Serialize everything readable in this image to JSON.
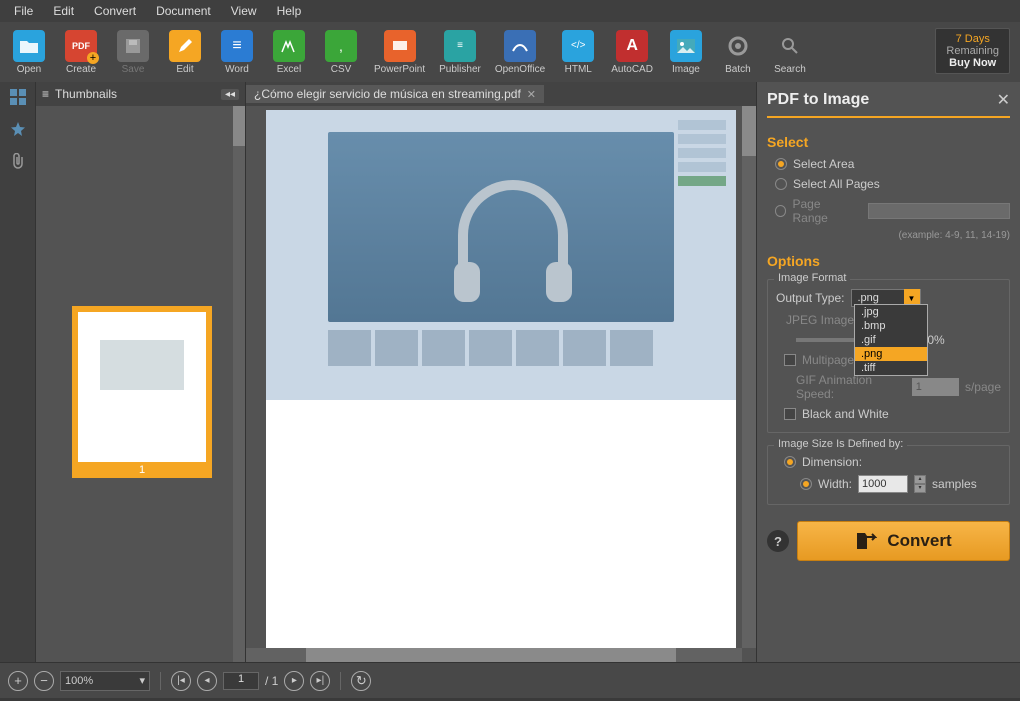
{
  "menubar": [
    "File",
    "Edit",
    "Convert",
    "Document",
    "View",
    "Help"
  ],
  "toolbar": {
    "open": "Open",
    "create": "Create",
    "save": "Save",
    "edit": "Edit",
    "word": "Word",
    "excel": "Excel",
    "csv": "CSV",
    "ppt": "PowerPoint",
    "publisher": "Publisher",
    "openoffice": "OpenOffice",
    "html": "HTML",
    "autocad": "AutoCAD",
    "image": "Image",
    "batch": "Batch",
    "search": "Search"
  },
  "buy": {
    "days": "7 Days",
    "remaining": "Remaining",
    "buy_now": "Buy Now"
  },
  "thumbnails": {
    "title": "Thumbnails",
    "page_num": "1"
  },
  "doc_tab": {
    "title": "¿Cómo elegir servicio de música en streaming.pdf"
  },
  "right_panel": {
    "title": "PDF to Image",
    "select_head": "Select",
    "select_area": "Select Area",
    "select_all": "Select All Pages",
    "page_range": "Page Range",
    "range_hint": "(example: 4-9, 11, 14-19)",
    "options_head": "Options",
    "img_format": "Image Format",
    "output_type": "Output Type:",
    "output_val": ".png",
    "dd_opts": [
      ".jpg",
      ".bmp",
      ".gif",
      ".png",
      ".tiff"
    ],
    "jpeg_q": "JPEG Image",
    "quality_val": "100%",
    "multipage": "Multipage Image",
    "gif_speed": "GIF Animation Speed:",
    "gif_val": "1",
    "gif_unit": "s/page",
    "bw": "Black and White",
    "img_size": "Image Size Is Defined by:",
    "dimension": "Dimension:",
    "width_lbl": "Width:",
    "width_val": "1000",
    "width_unit": "samples",
    "convert": "Convert"
  },
  "statusbar": {
    "zoom": "100%",
    "page_current": "1",
    "page_total": "1"
  }
}
